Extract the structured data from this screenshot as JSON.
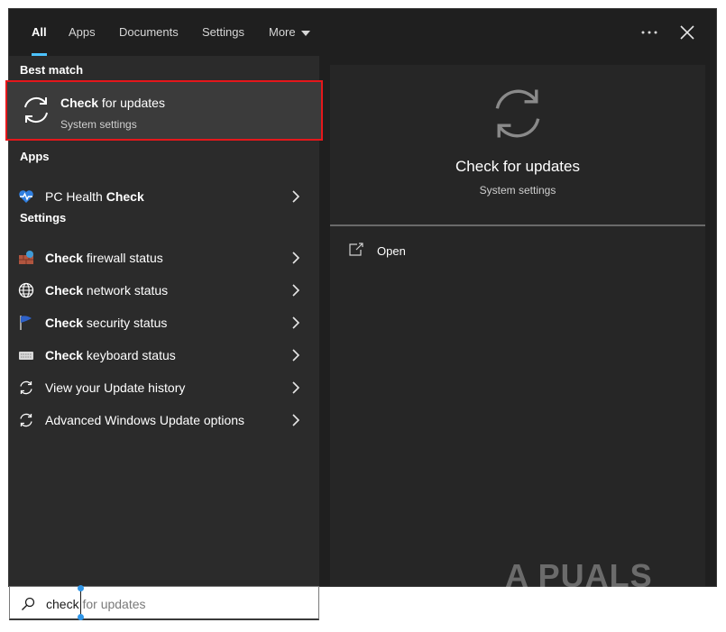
{
  "tabs": [
    {
      "label": "All",
      "active": true
    },
    {
      "label": "Apps"
    },
    {
      "label": "Documents"
    },
    {
      "label": "Settings"
    },
    {
      "label": "More"
    }
  ],
  "window_buttons": {
    "options_icon": "ellipsis-icon",
    "close_icon": "close-icon"
  },
  "left": {
    "best_match_heading": "Best match",
    "best_match": {
      "title_bold": "Check",
      "title_rest": " for updates",
      "subtitle": "System settings",
      "icon": "refresh-icon"
    },
    "apps_heading": "Apps",
    "apps": [
      {
        "pre": "PC Health ",
        "bold": "Check",
        "post": "",
        "icon": "health-heart-icon"
      }
    ],
    "settings_heading": "Settings",
    "settings": [
      {
        "pre": "",
        "bold": "Check",
        "post": " firewall status",
        "icon": "firewall-icon"
      },
      {
        "pre": "",
        "bold": "Check",
        "post": " network status",
        "icon": "globe-icon"
      },
      {
        "pre": "",
        "bold": "Check",
        "post": " security status",
        "icon": "flag-icon"
      },
      {
        "pre": "",
        "bold": "Check",
        "post": " keyboard status",
        "icon": "keyboard-icon"
      },
      {
        "pre": "View your Update history",
        "bold": "",
        "post": "",
        "icon": "refresh-icon"
      },
      {
        "pre": "Advanced Windows Update options",
        "bold": "",
        "post": "",
        "icon": "refresh-icon"
      }
    ]
  },
  "preview": {
    "title": "Check for updates",
    "subtitle": "System settings",
    "open_label": "Open",
    "icon": "refresh-icon"
  },
  "search": {
    "typed": "check",
    "suggestion": " for updates",
    "icon": "search-icon"
  },
  "watermark": "A PUALS",
  "colors": {
    "highlight_border": "#e4171b",
    "accent": "#4cc2ff"
  }
}
